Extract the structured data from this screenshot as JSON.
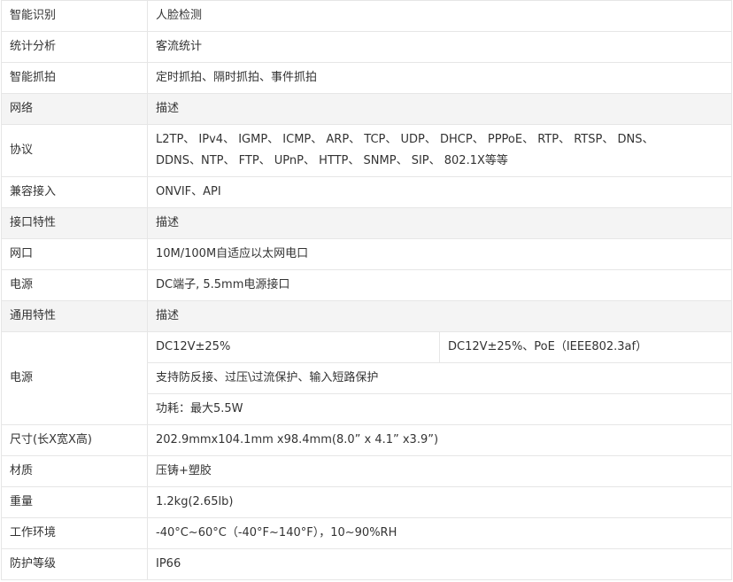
{
  "rows": {
    "r1": {
      "label": "智能识别",
      "value": "人脸检测"
    },
    "r2": {
      "label": "统计分析",
      "value": "客流统计"
    },
    "r3": {
      "label": "智能抓拍",
      "value": "定时抓拍、隔时抓拍、事件抓拍"
    },
    "r4": {
      "label": "网络",
      "value": "描述"
    },
    "r5": {
      "label": "协议",
      "value_line1": "L2TP、 IPv4、 IGMP、 ICMP、 ARP、 TCP、 UDP、 DHCP、 PPPoE、 RTP、 RTSP、 DNS、",
      "value_line2": "DDNS、NTP、 FTP、 UPnP、 HTTP、 SNMP、 SIP、 802.1X等等"
    },
    "r6": {
      "label": "兼容接入",
      "value": "ONVIF、API"
    },
    "r7": {
      "label": "接口特性",
      "value": "描述"
    },
    "r8": {
      "label": "网口",
      "value": "10M/100M自适应以太网电口"
    },
    "r9": {
      "label": "电源",
      "value": "DC端子, 5.5mm电源接口"
    },
    "r10": {
      "label": "通用特性",
      "value": "描述"
    },
    "r11": {
      "label": "电源",
      "value_a": "DC12V±25%",
      "value_b": "DC12V±25%、PoE（IEEE802.3af）",
      "value_2": "支持防反接、过压\\过流保护、输入短路保护",
      "value_3": "功耗：最大5.5W"
    },
    "r12": {
      "label": "尺寸(长X宽X高)",
      "value": "202.9mmx104.1mm x98.4mm(8.0” x 4.1” x3.9”)"
    },
    "r13": {
      "label": "材质",
      "value": "压铸+塑胶"
    },
    "r14": {
      "label": "重量",
      "value": "1.2kg(2.65lb)"
    },
    "r15": {
      "label": "工作环境",
      "value": "-40°C~60°C（-40°F~140°F），10~90%RH"
    },
    "r16": {
      "label": "防护等级",
      "value": "IP66"
    }
  }
}
